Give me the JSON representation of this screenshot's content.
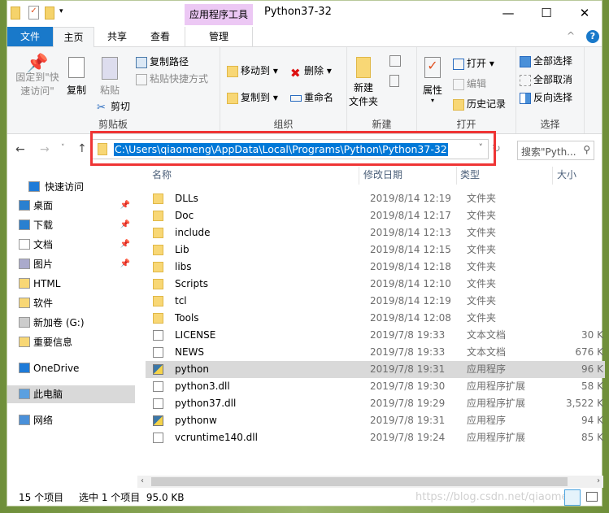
{
  "window": {
    "title": "Python37-32",
    "context_tab": "应用程序工具"
  },
  "tabs": [
    {
      "label": "文件"
    },
    {
      "label": "主页"
    },
    {
      "label": "共享"
    },
    {
      "label": "查看"
    },
    {
      "label": "管理"
    }
  ],
  "ribbon": {
    "clipboard": {
      "label": "剪贴板",
      "pin": "固定到\"快速访问\"",
      "copy": "复制",
      "paste": "粘贴",
      "copy_path": "复制路径",
      "paste_shortcut": "粘贴快捷方式",
      "cut": "剪切"
    },
    "organize": {
      "label": "组织",
      "move_to": "移动到",
      "copy_to": "复制到",
      "delete": "删除",
      "rename": "重命名"
    },
    "new": {
      "label": "新建",
      "new_folder": "新建\n文件夹"
    },
    "open": {
      "label": "打开",
      "properties": "属性",
      "open": "打开",
      "edit": "编辑",
      "history": "历史记录"
    },
    "select": {
      "label": "选择",
      "select_all": "全部选择",
      "select_none": "全部取消",
      "invert": "反向选择"
    }
  },
  "address": {
    "path": "C:\\Users\\qiaomeng\\AppData\\Local\\Programs\\Python\\Python37-32",
    "search_placeholder": "搜索\"Pyth..."
  },
  "sidebar": [
    {
      "label": "快速访问",
      "icon": "star-icon"
    },
    {
      "label": "桌面",
      "icon": "desktop-icon",
      "pinned": true
    },
    {
      "label": "下载",
      "icon": "download-icon",
      "pinned": true
    },
    {
      "label": "文档",
      "icon": "document-icon",
      "pinned": true
    },
    {
      "label": "图片",
      "icon": "picture-icon",
      "pinned": true
    },
    {
      "label": "HTML",
      "icon": "folder-icon"
    },
    {
      "label": "软件",
      "icon": "folder-icon"
    },
    {
      "label": "新加卷 (G:)",
      "icon": "drive-icon"
    },
    {
      "label": "重要信息",
      "icon": "folder-icon"
    },
    {
      "label": "OneDrive",
      "icon": "cloud-icon"
    },
    {
      "label": "此电脑",
      "icon": "computer-icon",
      "selected": true
    },
    {
      "label": "网络",
      "icon": "network-icon"
    }
  ],
  "columns": [
    "名称",
    "修改日期",
    "类型",
    "大小"
  ],
  "files": [
    {
      "name": "DLLs",
      "date": "2019/8/14 12:19",
      "type": "文件夹",
      "size": "",
      "icon": "folder"
    },
    {
      "name": "Doc",
      "date": "2019/8/14 12:17",
      "type": "文件夹",
      "size": "",
      "icon": "folder"
    },
    {
      "name": "include",
      "date": "2019/8/14 12:13",
      "type": "文件夹",
      "size": "",
      "icon": "folder"
    },
    {
      "name": "Lib",
      "date": "2019/8/14 12:15",
      "type": "文件夹",
      "size": "",
      "icon": "folder"
    },
    {
      "name": "libs",
      "date": "2019/8/14 12:18",
      "type": "文件夹",
      "size": "",
      "icon": "folder"
    },
    {
      "name": "Scripts",
      "date": "2019/8/14 12:10",
      "type": "文件夹",
      "size": "",
      "icon": "folder"
    },
    {
      "name": "tcl",
      "date": "2019/8/14 12:19",
      "type": "文件夹",
      "size": "",
      "icon": "folder"
    },
    {
      "name": "Tools",
      "date": "2019/8/14 12:08",
      "type": "文件夹",
      "size": "",
      "icon": "folder"
    },
    {
      "name": "LICENSE",
      "date": "2019/7/8 19:33",
      "type": "文本文档",
      "size": "30 K",
      "icon": "text"
    },
    {
      "name": "NEWS",
      "date": "2019/7/8 19:33",
      "type": "文本文档",
      "size": "676 K",
      "icon": "text"
    },
    {
      "name": "python",
      "date": "2019/7/8 19:31",
      "type": "应用程序",
      "size": "96 K",
      "icon": "exe",
      "selected": true
    },
    {
      "name": "python3.dll",
      "date": "2019/7/8 19:30",
      "type": "应用程序扩展",
      "size": "58 K",
      "icon": "dll"
    },
    {
      "name": "python37.dll",
      "date": "2019/7/8 19:29",
      "type": "应用程序扩展",
      "size": "3,522 K",
      "icon": "dll"
    },
    {
      "name": "pythonw",
      "date": "2019/7/8 19:31",
      "type": "应用程序",
      "size": "94 K",
      "icon": "exe"
    },
    {
      "name": "vcruntime140.dll",
      "date": "2019/7/8 19:24",
      "type": "应用程序扩展",
      "size": "85 K",
      "icon": "dll"
    }
  ],
  "status": {
    "count": "15 个项目",
    "selection": "选中 1 个项目  95.0 KB"
  },
  "watermark": "https://blog.csdn.net/qiaomeng",
  "colors": {
    "accent": "#0078d7",
    "highlight_box": "#ef3535",
    "context_tab": "#ecc8f4",
    "selected_row": "#d9d9d9"
  }
}
